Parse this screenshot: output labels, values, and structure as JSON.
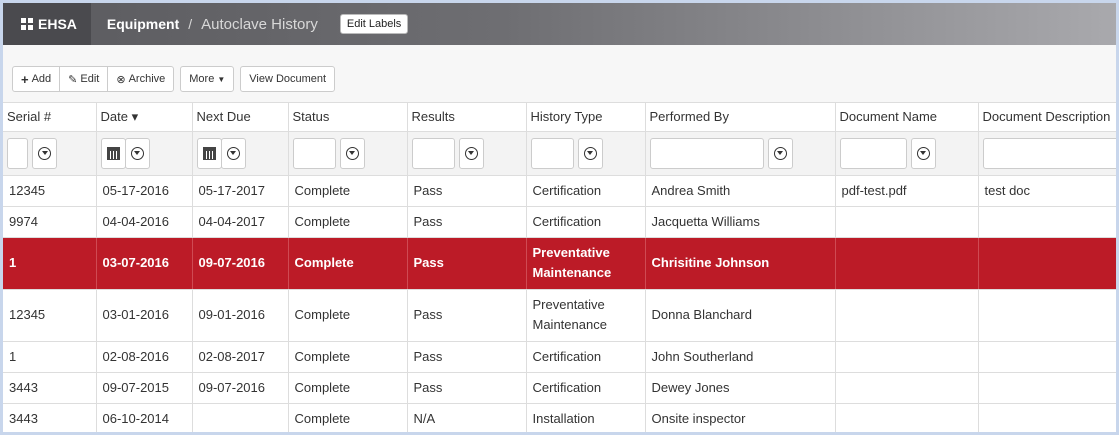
{
  "header": {
    "brand": "EHSA",
    "breadcrumb_parent": "Equipment",
    "breadcrumb_sep": "/",
    "breadcrumb_current": "Autoclave History",
    "edit_labels": "Edit Labels"
  },
  "toolbar": {
    "add": "Add",
    "edit": "Edit",
    "archive": "Archive",
    "more": "More",
    "view_document": "View Document"
  },
  "columns": [
    {
      "label": "Serial #"
    },
    {
      "label": "Date ▾"
    },
    {
      "label": "Next Due"
    },
    {
      "label": "Status"
    },
    {
      "label": "Results"
    },
    {
      "label": "History Type"
    },
    {
      "label": "Performed By"
    },
    {
      "label": "Document Name"
    },
    {
      "label": "Document Description"
    }
  ],
  "rows": [
    {
      "serial": "12345",
      "date": "05-17-2016",
      "next_due": "05-17-2017",
      "status": "Complete",
      "results": "Pass",
      "history_type": "Certification",
      "performed_by": "Andrea Smith",
      "doc_name": "pdf-test.pdf",
      "doc_desc": "test doc"
    },
    {
      "serial": "9974",
      "date": "04-04-2016",
      "next_due": "04-04-2017",
      "status": "Complete",
      "results": "Pass",
      "history_type": "Certification",
      "performed_by": "Jacquetta Williams",
      "doc_name": "",
      "doc_desc": ""
    },
    {
      "serial": "1",
      "date": "03-07-2016",
      "next_due": "09-07-2016",
      "status": "Complete",
      "results": "Pass",
      "history_type": "Preventative Maintenance",
      "performed_by": "Chrisitine Johnson",
      "doc_name": "",
      "doc_desc": ""
    },
    {
      "serial": "12345",
      "date": "03-01-2016",
      "next_due": "09-01-2016",
      "status": "Complete",
      "results": "Pass",
      "history_type": "Preventative Maintenance",
      "performed_by": "Donna Blanchard",
      "doc_name": "",
      "doc_desc": ""
    },
    {
      "serial": "1",
      "date": "02-08-2016",
      "next_due": "02-08-2017",
      "status": "Complete",
      "results": "Pass",
      "history_type": "Certification",
      "performed_by": "John Southerland",
      "doc_name": "",
      "doc_desc": ""
    },
    {
      "serial": "3443",
      "date": "09-07-2015",
      "next_due": "09-07-2016",
      "status": "Complete",
      "results": "Pass",
      "history_type": "Certification",
      "performed_by": "Dewey Jones",
      "doc_name": "",
      "doc_desc": ""
    },
    {
      "serial": "3443",
      "date": "06-10-2014",
      "next_due": "",
      "status": "Complete",
      "results": "N/A",
      "history_type": "Installation",
      "performed_by": "Onsite inspector",
      "doc_name": "",
      "doc_desc": ""
    }
  ],
  "colors": {
    "selected_row": "#bc1b27",
    "header_bar": "#6e6e72"
  },
  "icons": [
    "grid-icon",
    "plus-icon",
    "pencil-icon",
    "archive-icon",
    "caret-down-icon",
    "calendar-icon",
    "filter-icon"
  ]
}
